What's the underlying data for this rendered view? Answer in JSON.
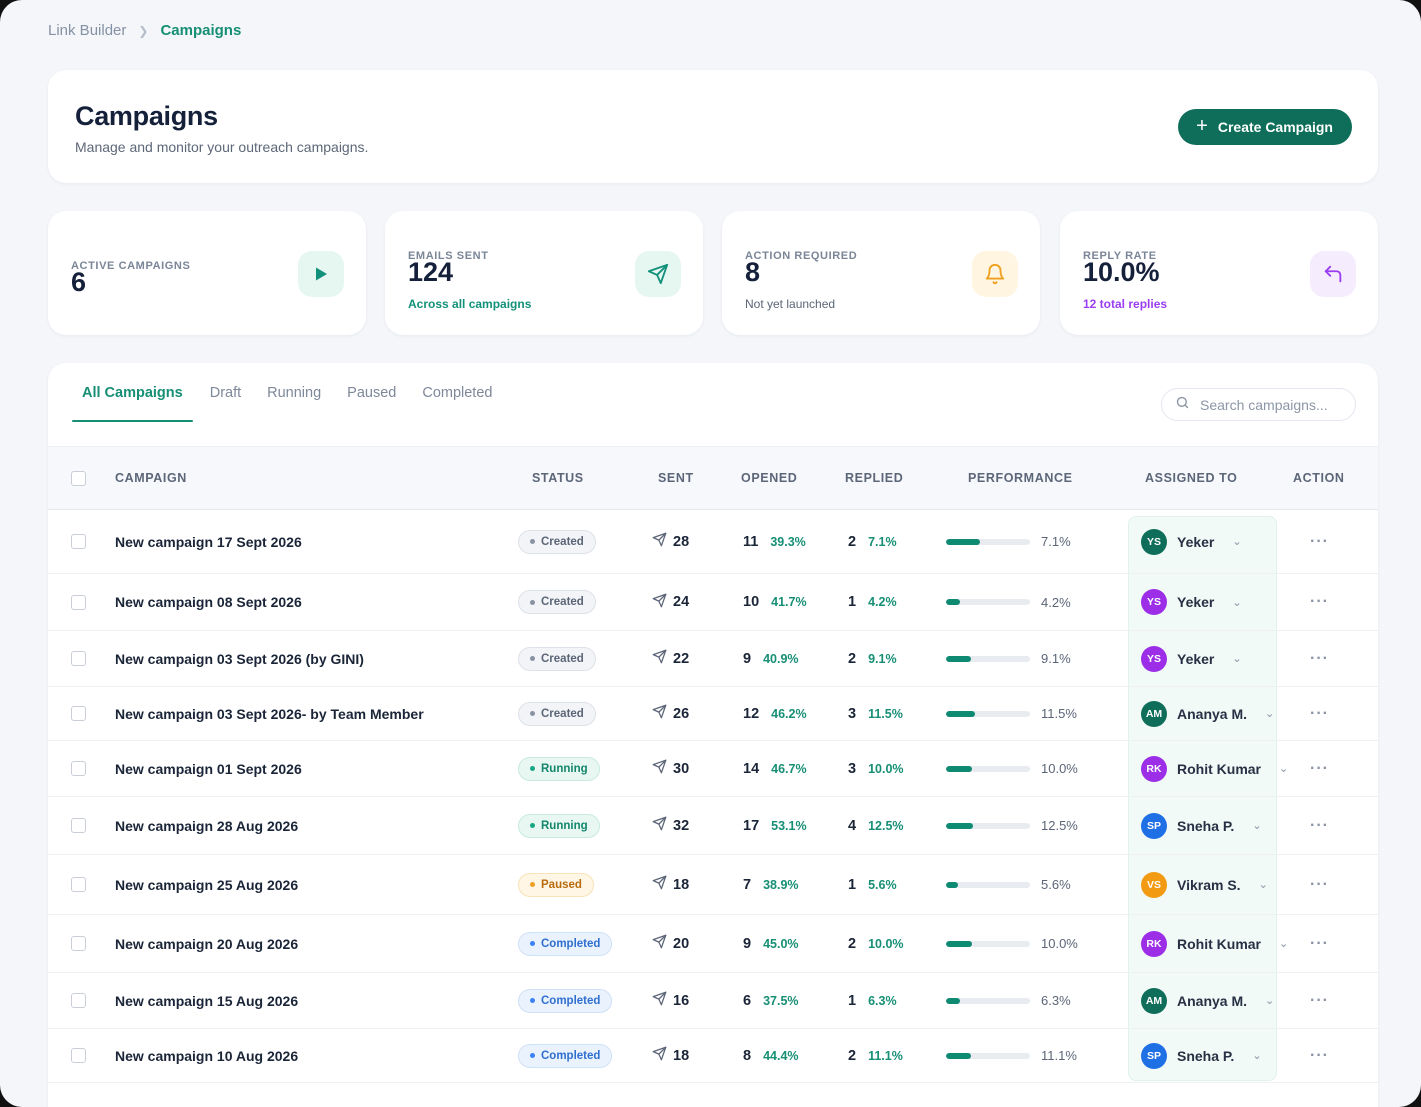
{
  "breadcrumb": {
    "parent": "Link Builder",
    "current": "Campaigns"
  },
  "header": {
    "title": "Campaigns",
    "subtitle": "Manage and monitor your outreach campaigns.",
    "create_label": "Create Campaign"
  },
  "stats": [
    {
      "label": "ACTIVE CAMPAIGNS",
      "value": "6",
      "sub": "",
      "icon": "play-icon",
      "accent": "#12917a"
    },
    {
      "label": "EMAILS SENT",
      "value": "124",
      "sub": "Across all campaigns",
      "icon": "send-icon",
      "accent": "#12917a"
    },
    {
      "label": "ACTION REQUIRED",
      "value": "8",
      "sub": "Not yet launched",
      "icon": "bell-icon",
      "accent": "#f0a020"
    },
    {
      "label": "REPLY RATE",
      "value": "10.0%",
      "sub": "12 total replies",
      "icon": "reply-icon",
      "accent": "#9b3df0"
    }
  ],
  "tabs": [
    "All Campaigns",
    "Draft",
    "Running",
    "Paused",
    "Completed"
  ],
  "search": {
    "placeholder": "Search campaigns..."
  },
  "columns": {
    "campaign": "CAMPAIGN",
    "status": "STATUS",
    "sent": "SENT",
    "opened": "OPENED",
    "replied": "REPLIED",
    "performance": "PERFORMANCE",
    "assigned": "ASSIGNED TO",
    "action": "ACTION"
  },
  "colors": {
    "teal": "#0f6e5a",
    "accent": "#168f75"
  },
  "rows": [
    {
      "name": "New campaign 17 Sept 2026",
      "status": "Created",
      "sent": "28",
      "opened": "11",
      "opened_pct": "39.3%",
      "replied": "2",
      "replied_pct": "7.1%",
      "perf": "7.1%",
      "perf_value": 0.4,
      "initials": "YS",
      "assignee": "Yeker",
      "avatar_color": "#0f6e5a"
    },
    {
      "name": "New campaign 08 Sept 2026",
      "status": "Created",
      "sent": "24",
      "opened": "10",
      "opened_pct": "41.7%",
      "replied": "1",
      "replied_pct": "4.2%",
      "perf": "4.2%",
      "perf_value": 0.17,
      "initials": "YS",
      "assignee": "Yeker",
      "avatar_color": "#9b2ee6"
    },
    {
      "name": "New campaign 03 Sept 2026 (by GINI)",
      "status": "Created",
      "sent": "22",
      "opened": "9",
      "opened_pct": "40.9%",
      "replied": "2",
      "replied_pct": "9.1%",
      "perf": "9.1%",
      "perf_value": 0.3,
      "initials": "YS",
      "assignee": "Yeker",
      "avatar_color": "#9b2ee6"
    },
    {
      "name": "New campaign 03 Sept 2026- by Team Member",
      "status": "Created",
      "sent": "26",
      "opened": "12",
      "opened_pct": "46.2%",
      "replied": "3",
      "replied_pct": "11.5%",
      "perf": "11.5%",
      "perf_value": 0.34,
      "initials": "AM",
      "assignee": "Ananya M.",
      "avatar_color": "#0f6e5a"
    },
    {
      "name": "New campaign 01 Sept 2026",
      "status": "Running",
      "sent": "30",
      "opened": "14",
      "opened_pct": "46.7%",
      "replied": "3",
      "replied_pct": "10.0%",
      "perf": "10.0%",
      "perf_value": 0.31,
      "initials": "RK",
      "assignee": "Rohit Kumar",
      "avatar_color": "#9b2ee6"
    },
    {
      "name": "New campaign 28 Aug 2026",
      "status": "Running",
      "sent": "32",
      "opened": "17",
      "opened_pct": "53.1%",
      "replied": "4",
      "replied_pct": "12.5%",
      "perf": "12.5%",
      "perf_value": 0.32,
      "initials": "SP",
      "assignee": "Sneha P.",
      "avatar_color": "#1f6fe5"
    },
    {
      "name": "New campaign 25 Aug 2026",
      "status": "Paused",
      "sent": "18",
      "opened": "7",
      "opened_pct": "38.9%",
      "replied": "1",
      "replied_pct": "5.6%",
      "perf": "5.6%",
      "perf_value": 0.14,
      "initials": "VS",
      "assignee": "Vikram S.",
      "avatar_color": "#f29a12"
    },
    {
      "name": "New campaign 20 Aug 2026",
      "status": "Completed",
      "sent": "20",
      "opened": "9",
      "opened_pct": "45.0%",
      "replied": "2",
      "replied_pct": "10.0%",
      "perf": "10.0%",
      "perf_value": 0.31,
      "initials": "RK",
      "assignee": "Rohit Kumar",
      "avatar_color": "#9b2ee6"
    },
    {
      "name": "New campaign 15 Aug 2026",
      "status": "Completed",
      "sent": "16",
      "opened": "6",
      "opened_pct": "37.5%",
      "replied": "1",
      "replied_pct": "6.3%",
      "perf": "6.3%",
      "perf_value": 0.17,
      "initials": "AM",
      "assignee": "Ananya M.",
      "avatar_color": "#0f6e5a"
    },
    {
      "name": "New campaign 10 Aug 2026",
      "status": "Completed",
      "sent": "18",
      "opened": "8",
      "opened_pct": "44.4%",
      "replied": "2",
      "replied_pct": "11.1%",
      "perf": "11.1%",
      "perf_value": 0.3,
      "initials": "SP",
      "assignee": "Sneha P.",
      "avatar_color": "#1f6fe5"
    }
  ]
}
